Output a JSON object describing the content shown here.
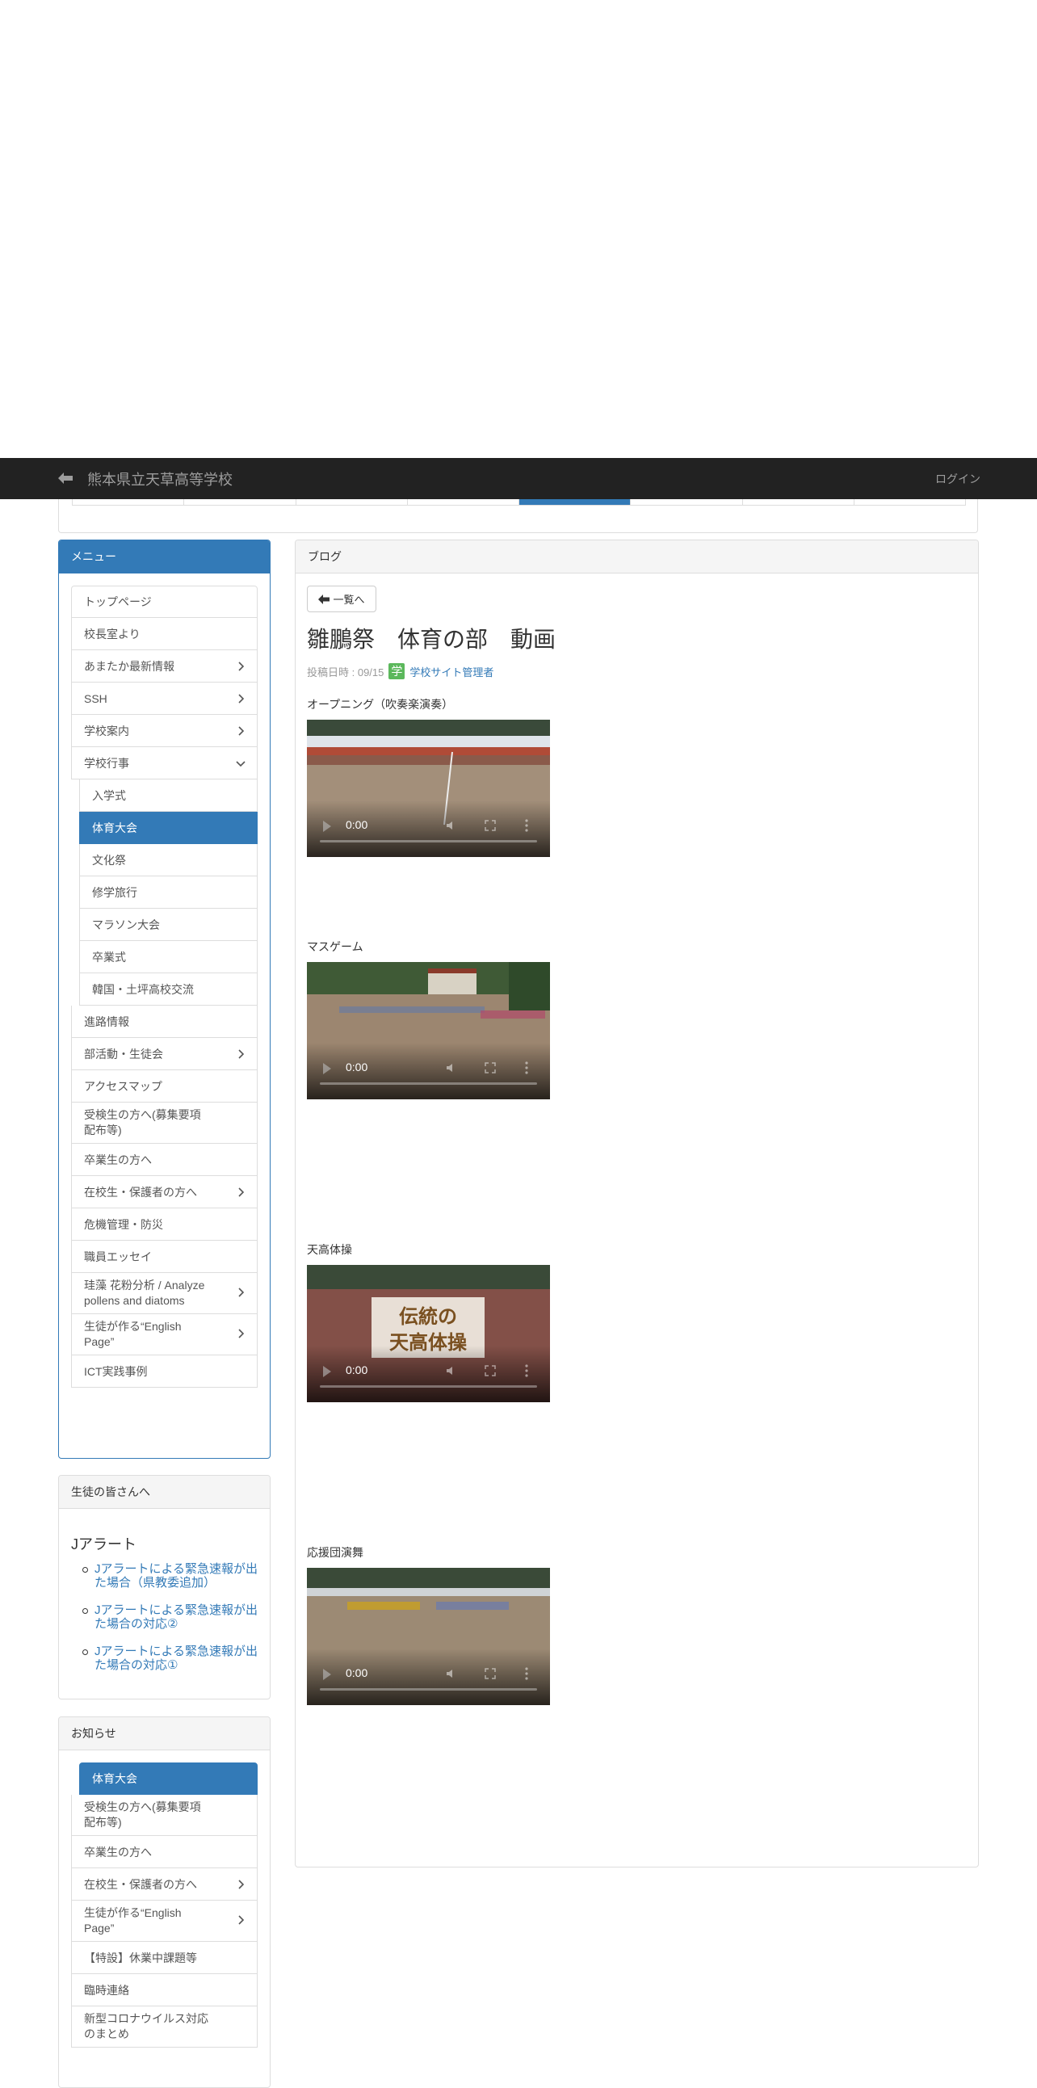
{
  "navbar": {
    "site_title": "熊本県立天草高等学校",
    "login": "ログイン"
  },
  "menu_panel": {
    "heading": "メニュー",
    "items": [
      {
        "label": "トップページ",
        "has_children": false
      },
      {
        "label": "校長室より",
        "has_children": false
      },
      {
        "label": "あまたか最新情報",
        "has_children": true
      },
      {
        "label": "SSH",
        "has_children": true
      },
      {
        "label": "学校案内",
        "has_children": true
      },
      {
        "label": "学校行事",
        "has_children": true,
        "expanded": true
      },
      {
        "label": "入学式",
        "sub": true
      },
      {
        "label": "体育大会",
        "sub": true,
        "active": true
      },
      {
        "label": "文化祭",
        "sub": true
      },
      {
        "label": "修学旅行",
        "sub": true
      },
      {
        "label": "マラソン大会",
        "sub": true
      },
      {
        "label": "卒業式",
        "sub": true
      },
      {
        "label": "韓国・土坪高校交流",
        "sub": true
      },
      {
        "label": "進路情報",
        "has_children": false
      },
      {
        "label": "部活動・生徒会",
        "has_children": true
      },
      {
        "label": "アクセスマップ",
        "has_children": false
      },
      {
        "label": "受検生の方へ(募集要項配布等)",
        "has_children": false,
        "tall": true
      },
      {
        "label": "卒業生の方へ",
        "has_children": false
      },
      {
        "label": "在校生・保護者の方へ",
        "has_children": true
      },
      {
        "label": "危機管理・防災",
        "has_children": false
      },
      {
        "label": "職員エッセイ",
        "has_children": false
      },
      {
        "label": "珪藻 花粉分析 / Analyze pollens and diatoms",
        "has_children": true,
        "tall": true
      },
      {
        "label": "生徒が作る“English Page”",
        "has_children": true,
        "tall": true
      },
      {
        "label": "ICT実践事例",
        "has_children": false
      }
    ]
  },
  "students_panel": {
    "heading": "生徒の皆さんへ",
    "section_title": "Jアラート",
    "links": [
      "Jアラートによる緊急速報が出た場合（県教委追加）",
      "Jアラートによる緊急速報が出た場合の対応②",
      "Jアラートによる緊急速報が出た場合の対応①"
    ]
  },
  "notice_panel": {
    "heading": "お知らせ",
    "items": [
      {
        "label": "体育大会",
        "active": true,
        "sub": true
      },
      {
        "label": "受検生の方へ(募集要項配布等)",
        "tall": true
      },
      {
        "label": "卒業生の方へ"
      },
      {
        "label": "在校生・保護者の方へ",
        "has_children": true
      },
      {
        "label": "生徒が作る“English Page”",
        "has_children": true,
        "tall": true
      },
      {
        "label": "【特設】休業中課題等"
      },
      {
        "label": "臨時連絡"
      },
      {
        "label": "新型コロナウイルス対応のまとめ",
        "tall": true
      }
    ]
  },
  "blog": {
    "heading": "ブログ",
    "back_button": "一覧へ",
    "title": "雛鵬祭　体育の部　動画",
    "posted_label": "投稿日時 : 09/15",
    "author_badge": "学",
    "author": "学校サイト管理者",
    "videos": [
      {
        "label": "オープニング（吹奏楽演奏）",
        "time": "0:00"
      },
      {
        "label": "マスゲーム",
        "time": "0:00"
      },
      {
        "label": "天高体操",
        "time": "0:00",
        "overlay_line1": "伝統の",
        "overlay_line2": "天高体操"
      },
      {
        "label": "応援団演舞",
        "time": "0:00"
      }
    ]
  },
  "colors": {
    "primary": "#337ab7",
    "navbar": "#222222",
    "badge": "#5cb85c"
  }
}
